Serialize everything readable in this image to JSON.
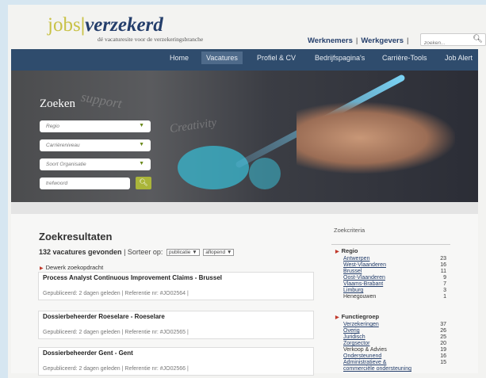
{
  "header": {
    "logo_jobs": "jobs",
    "logo_verzekerd": "verzekerd",
    "tagline": "dé vacaturesite voor de verzekeringsbranche",
    "link_werknemers": "Werknemers",
    "link_werkgevers": "Werkgevers",
    "search_placeholder": "zoeken..."
  },
  "nav": {
    "items": [
      "Home",
      "Vacatures",
      "Profiel & CV",
      "Bedrijfspagina's",
      "Carrière-Tools",
      "Job Alert"
    ],
    "active": "Vacatures"
  },
  "hero": {
    "title": "Zoeken",
    "regio": "Regio",
    "carriereniveau": "Carrièreniveau",
    "soort": "Soort Organisatie",
    "trefwoord": "trefwoord",
    "chalk_support": "support",
    "chalk_creativity": "Creativity"
  },
  "results": {
    "title": "Zoekresultaten",
    "count": "132 vacatures gevonden",
    "sort_label": "Sorteer op:",
    "sort_value": "publicatie",
    "order_value": "aflopend",
    "save_search": "Dewerk zoekopdracht",
    "jobs": [
      {
        "title": "Process Analyst Continuous Improvement Claims - Brussel",
        "meta": "Gepubliceerd: 2 dagen geleden | Referentie nr: #JO02564 |"
      },
      {
        "title": "Dossierbeheerder Roeselare - Roeselare",
        "meta": "Gepubliceerd: 2 dagen geleden | Referentie nr: #JO02565 |"
      },
      {
        "title": "Dossierbeheerder Gent - Gent",
        "meta": "Gepubliceerd: 2 dagen geleden | Referentie nr: #JO02566 |"
      }
    ]
  },
  "criteria": {
    "title": "Zoekcriteria",
    "regio_title": "Regio",
    "regio": [
      {
        "label": "Antwerpen",
        "count": "23"
      },
      {
        "label": "West-Vlaanderen",
        "count": "16"
      },
      {
        "label": "Brussel",
        "count": "11"
      },
      {
        "label": "Oost-Vlaanderen",
        "count": "9"
      },
      {
        "label": "Vlaams-Brabant",
        "count": "7"
      },
      {
        "label": "Limburg",
        "count": "3"
      },
      {
        "label": "Henegouwen",
        "count": "1"
      }
    ],
    "functie_title": "Functiegroep",
    "functie": [
      {
        "label": "Verzekeringen",
        "count": "37"
      },
      {
        "label": "Overig",
        "count": "26"
      },
      {
        "label": "Juridisch",
        "count": "25"
      },
      {
        "label": "Zorgsector",
        "count": "20"
      },
      {
        "label": "Verkoop & Advies",
        "count": "19"
      },
      {
        "label": "Ondersteunend",
        "count": "16"
      },
      {
        "label": "Administratieve &",
        "count": "15"
      },
      {
        "label": "commerciële ondersteuning",
        "count": ""
      }
    ]
  },
  "colors": {
    "brand_blue": "#243e6b",
    "brand_yellow": "#c9c247",
    "nav_bg": "#2f4c6d",
    "accent_green": "#aab53a"
  }
}
